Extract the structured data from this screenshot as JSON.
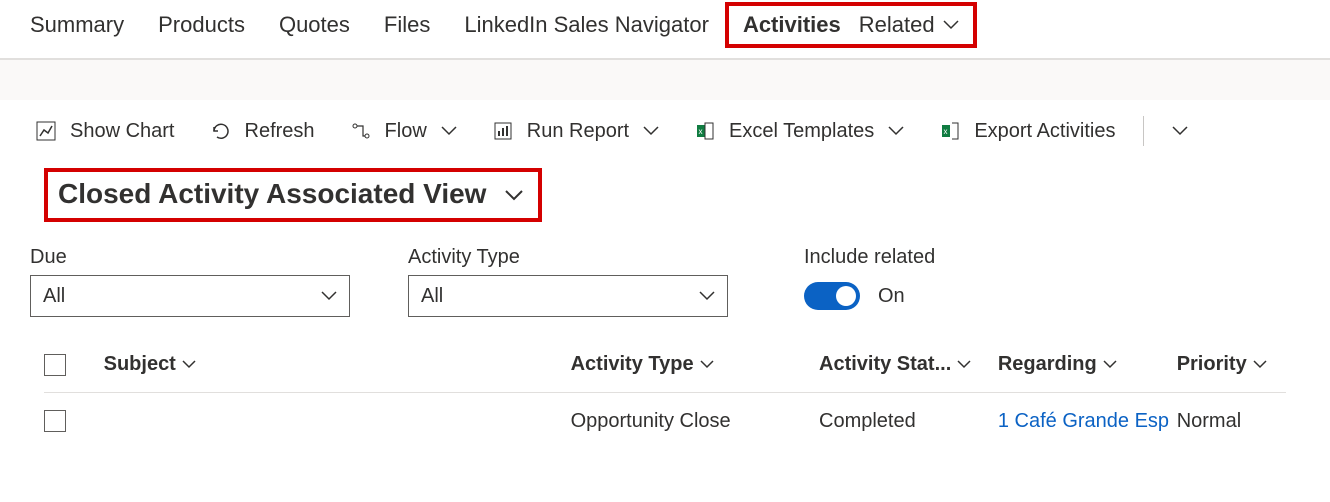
{
  "nav": {
    "tabs": [
      "Summary",
      "Products",
      "Quotes",
      "Files",
      "LinkedIn Sales Navigator",
      "Activities",
      "Related"
    ],
    "activeIndex": 5
  },
  "toolbar": {
    "show_chart": "Show Chart",
    "refresh": "Refresh",
    "flow": "Flow",
    "run_report": "Run Report",
    "excel_templates": "Excel Templates",
    "export_activities": "Export Activities"
  },
  "view": {
    "name": "Closed Activity Associated View"
  },
  "filters": {
    "due": {
      "label": "Due",
      "value": "All"
    },
    "activity_type": {
      "label": "Activity Type",
      "value": "All"
    },
    "include_related": {
      "label": "Include related",
      "state": "On"
    }
  },
  "table": {
    "headers": {
      "subject": "Subject",
      "activity_type": "Activity Type",
      "activity_status": "Activity Stat...",
      "regarding": "Regarding",
      "priority": "Priority"
    },
    "rows": [
      {
        "subject": "",
        "activity_type": "Opportunity Close",
        "activity_status": "Completed",
        "regarding": "1 Café Grande Esp",
        "priority": "Normal"
      }
    ]
  },
  "colors": {
    "highlight": "#d40000",
    "accent": "#0b62c4"
  }
}
